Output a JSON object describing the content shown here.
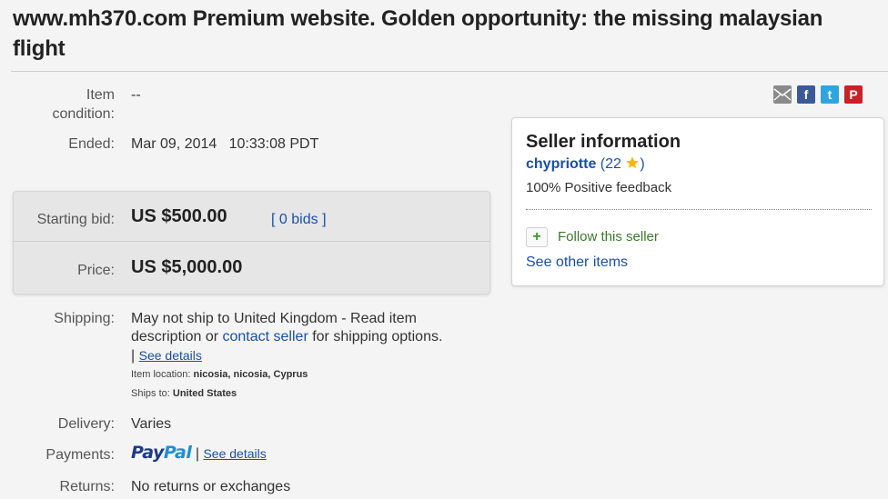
{
  "listing": {
    "title": "www.mh370.com Premium website. Golden opportunity: the missing malaysian flight"
  },
  "details": {
    "condition_label_1": "Item",
    "condition_label_2": "condition:",
    "condition_value": "--",
    "ended_label": "Ended:",
    "ended_date": "Mar 09, 2014",
    "ended_time": "10:33:08 PDT",
    "starting_bid_label": "Starting bid:",
    "starting_bid_value": "US $500.00",
    "bids_open": "[",
    "bids_link": "0 bids",
    "bids_close": "]",
    "price_label": "Price:",
    "price_value": "US $5,000.00",
    "shipping_label": "Shipping:",
    "shipping_line1": "May not ship to United Kingdom - Read item",
    "shipping_line2_pre": "description or ",
    "shipping_contact_link": "contact seller",
    "shipping_line2_post": " for shipping options.",
    "shipping_pipe": "|",
    "shipping_see_details": "See details",
    "item_location_label": "Item location:",
    "item_location_value": "nicosia, nicosia, Cyprus",
    "ships_to_label": "Ships to:",
    "ships_to_value": "United States",
    "delivery_label": "Delivery:",
    "delivery_value": "Varies",
    "payments_label": "Payments:",
    "paypal_pay": "Pay",
    "paypal_pal": "Pal",
    "payments_pipe": "|",
    "payments_see_details": "See details",
    "returns_label": "Returns:",
    "returns_value": "No returns or exchanges"
  },
  "share": {
    "icons": [
      "email-icon",
      "facebook-icon",
      "twitter-icon",
      "pinterest-icon"
    ],
    "facebook_glyph": "f",
    "twitter_glyph": "t",
    "pinterest_glyph": "P",
    "colors": {
      "email": "#8a8a8a",
      "facebook": "#3b5998",
      "twitter": "#2fa5e0",
      "pinterest": "#cb2027"
    }
  },
  "seller": {
    "heading": "Seller information",
    "name": "chypriotte",
    "feedback_open": "(",
    "feedback_score": "22",
    "feedback_close": ")",
    "star_icon": "star-icon",
    "positive_feedback": "100% Positive feedback",
    "follow_plus": "+",
    "follow_label": "Follow this seller",
    "see_other": "See other items"
  },
  "colors": {
    "link": "#1a4fa8",
    "background": "#f4f4f4",
    "bid_box": "#e6e6e6",
    "follow_green": "#3a9a2a",
    "star": "#f5b800"
  }
}
